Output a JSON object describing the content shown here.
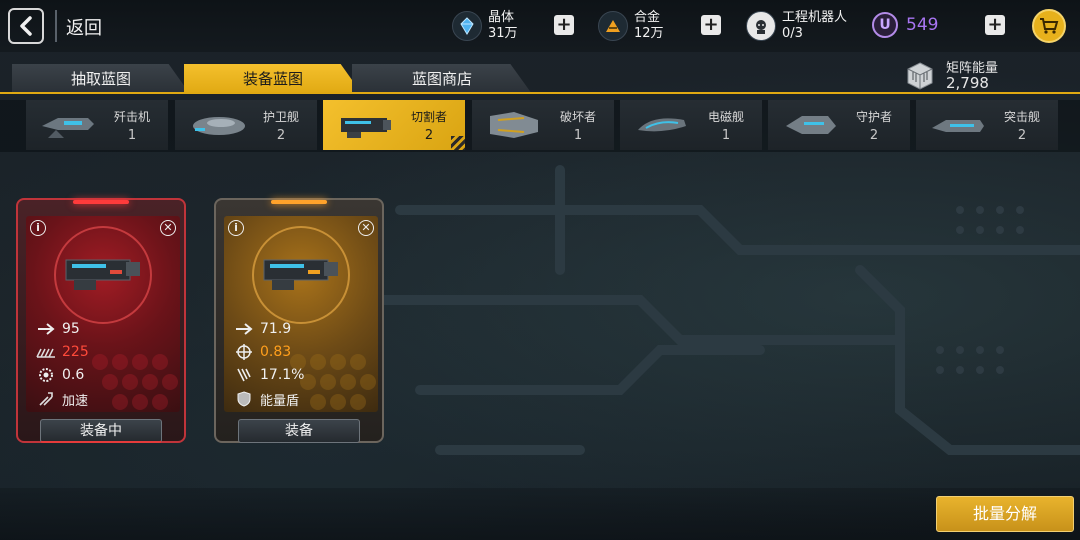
{
  "header": {
    "back_label": "返回",
    "resources": [
      {
        "name": "晶体",
        "amount": "31万",
        "icon": "crystal-icon",
        "color": "#4fb3f0"
      },
      {
        "name": "合金",
        "amount": "12万",
        "icon": "alloy-icon",
        "color": "#f0a020"
      },
      {
        "name": "工程机器人",
        "amount": "0/3",
        "icon": "robot-icon"
      }
    ],
    "u_currency": {
      "symbol": "U",
      "amount": "549",
      "color": "#a875f2"
    }
  },
  "tabs": [
    {
      "label": "抽取蓝图",
      "active": false
    },
    {
      "label": "装备蓝图",
      "active": true
    },
    {
      "label": "蓝图商店",
      "active": false
    }
  ],
  "matrix_energy": {
    "label": "矩阵能量",
    "value": "2,798"
  },
  "ship_types": [
    {
      "name": "歼击机",
      "count": "1",
      "active": false
    },
    {
      "name": "护卫舰",
      "count": "2",
      "active": false
    },
    {
      "name": "切割者",
      "count": "2",
      "active": true
    },
    {
      "name": "破坏者",
      "count": "1",
      "active": false
    },
    {
      "name": "电磁舰",
      "count": "1",
      "active": false
    },
    {
      "name": "守护者",
      "count": "2",
      "active": false
    },
    {
      "name": "突击舰",
      "count": "2",
      "active": false
    }
  ],
  "cards": [
    {
      "rarity_color": "#c0343a",
      "stats": [
        {
          "icon": "speed-arrow-icon",
          "value": "95",
          "highlight": ""
        },
        {
          "icon": "damage-bars-icon",
          "value": "225",
          "highlight": "red"
        },
        {
          "icon": "rate-gear-icon",
          "value": "0.6",
          "highlight": ""
        },
        {
          "icon": "boost-icon",
          "value": "加速",
          "highlight": ""
        }
      ],
      "button_label": "装备中"
    },
    {
      "rarity_color": "#e0902a",
      "stats": [
        {
          "icon": "speed-arrow-icon",
          "value": "71.9",
          "highlight": ""
        },
        {
          "icon": "crosshair-icon",
          "value": "0.83",
          "highlight": "orange"
        },
        {
          "icon": "crit-claw-icon",
          "value": "17.1%",
          "highlight": ""
        },
        {
          "icon": "shield-icon",
          "value": "能量盾",
          "highlight": ""
        }
      ],
      "button_label": "装备"
    }
  ],
  "footer": {
    "batch_label": "批量分解"
  }
}
